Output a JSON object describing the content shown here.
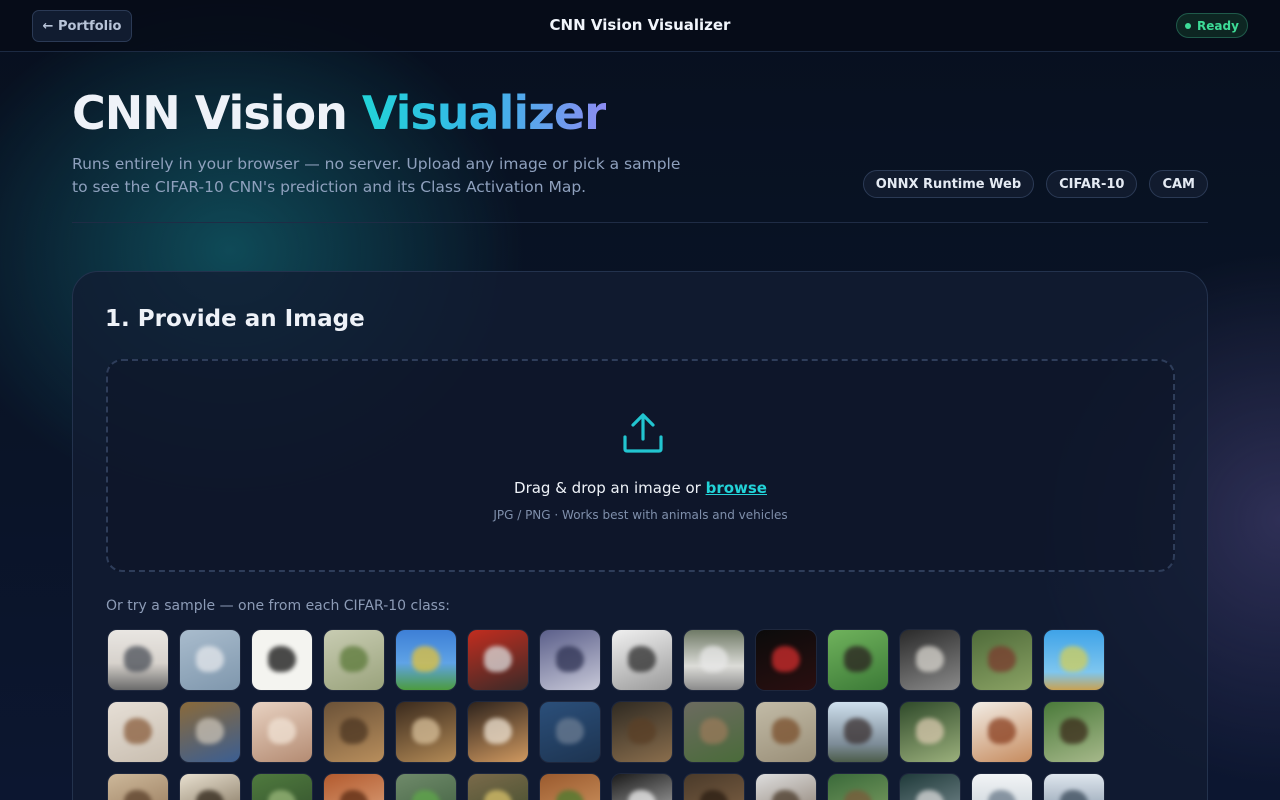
{
  "topbar": {
    "back_label": "← Portfolio",
    "title": "CNN Vision Visualizer",
    "status_label": "Ready",
    "status_color": "#3ddc97"
  },
  "hero": {
    "title_main": "CNN Vision ",
    "title_accent": "Visualizer",
    "subtitle_line1": "Runs entirely in your browser — no server. Upload any image or pick a sample",
    "subtitle_line2": "to see the CIFAR-10 CNN's prediction and its Class Activation Map.",
    "chips": [
      "ONNX Runtime Web",
      "CIFAR-10",
      "CAM"
    ]
  },
  "input_panel": {
    "title": "1. Provide an Image",
    "icon": "upload-icon",
    "drop_prefix": "Drag & drop an image or ",
    "browse_label": "browse",
    "hint": "JPG / PNG · Works best with animals and vehicles",
    "samples_label": "Or try a sample — one from each CIFAR-10 class:"
  },
  "samples": [
    {
      "bg": "linear-gradient(180deg,#e9e6e2 0%,#d7d2cc 55%,#6a6a6a 100%)",
      "fg": "#4a4f58"
    },
    {
      "bg": "linear-gradient(160deg,#a9bccd 0%,#7f97ad 100%)",
      "fg": "#e5e8ec"
    },
    {
      "bg": "#f4f4f0",
      "fg": "#111111"
    },
    {
      "bg": "linear-gradient(160deg,#c8ccb2 0%,#9aa37c 100%)",
      "fg": "#5c7a3a"
    },
    {
      "bg": "linear-gradient(180deg,#3d7fd6 0%,#5fa3e6 55%,#4c9b3e 100%)",
      "fg": "#e3c23a"
    },
    {
      "bg": "linear-gradient(160deg,#c22d1f 0%,#3a2a28 100%)",
      "fg": "#dcdcdc"
    },
    {
      "bg": "linear-gradient(160deg,#5b5f8a 0%,#c7c8d8 100%)",
      "fg": "#2d3152"
    },
    {
      "bg": "linear-gradient(160deg,#f0f0f0 0%,#9a9a9a 100%)",
      "fg": "#2e2e2e"
    },
    {
      "bg": "linear-gradient(180deg,#6f7a66 0%,#dcdcd8 60%,#8a8a8a 100%)",
      "fg": "#e8e8e8"
    },
    {
      "bg": "linear-gradient(160deg,#0b0b0b 0%,#2a0f10 100%)",
      "fg": "#d22d2d"
    },
    {
      "bg": "linear-gradient(160deg,#6fb25c 0%,#3c7a37 100%)",
      "fg": "#2a2020"
    },
    {
      "bg": "linear-gradient(160deg,#2a2a2a 0%,#8a8a8a 100%)",
      "fg": "#d9d6cf"
    },
    {
      "bg": "linear-gradient(160deg,#4f6b3a 0%,#8aa264 100%)",
      "fg": "#7a3b2e"
    },
    {
      "bg": "linear-gradient(180deg,#3fa3e8 0%,#7ec6ef 70%,#c8a253 100%)",
      "fg": "#d2cf5a"
    },
    {
      "bg": "linear-gradient(160deg,#e6dfd6 0%,#c9beb0 100%)",
      "fg": "#8a5e3d"
    },
    {
      "bg": "linear-gradient(160deg,#8a6a3a 0%,#3b5e92 100%)",
      "fg": "#c9c2b6"
    },
    {
      "bg": "linear-gradient(160deg,#e8d2c2 0%,#b48b72 100%)",
      "fg": "#f1e3d5"
    },
    {
      "bg": "linear-gradient(160deg,#6b5238 0%,#b88e5c 100%)",
      "fg": "#4c3622"
    },
    {
      "bg": "linear-gradient(160deg,#3a2a1d 0%,#b38a56 100%)",
      "fg": "#d8c09a"
    },
    {
      "bg": "linear-gradient(160deg,#2e231c 0%,#d09960 100%)",
      "fg": "#efe3d2"
    },
    {
      "bg": "linear-gradient(160deg,#2b4f7a 0%,#1d3451 100%)",
      "fg": "#6b7c92"
    },
    {
      "bg": "linear-gradient(160deg,#2f2a22 0%,#8a6e4d 100%)",
      "fg": "#5a3f26"
    },
    {
      "bg": "linear-gradient(160deg,#6c6b60 0%,#4a6b3a 100%)",
      "fg": "#9a7a5a"
    },
    {
      "bg": "linear-gradient(160deg,#c2bba7 0%,#9a8f78 100%)",
      "fg": "#7a4f2c"
    },
    {
      "bg": "linear-gradient(180deg,#cfe0ee 0%,#7d8c98 70%,#4c5c4a 100%)",
      "fg": "#3a3030"
    },
    {
      "bg": "linear-gradient(160deg,#2f4a2a 0%,#9bb07c 100%)",
      "fg": "#d9c9ae"
    },
    {
      "bg": "linear-gradient(160deg,#f2ede6 0%,#c68b5e 100%)",
      "fg": "#8a3f20"
    },
    {
      "bg": "linear-gradient(160deg,#4a7a3a 0%,#a6b88a 100%)",
      "fg": "#3a2a1a"
    },
    {
      "bg": "linear-gradient(160deg,#cdb89a 0%,#8c6d4f 100%)",
      "fg": "#5a3f2a"
    },
    {
      "bg": "linear-gradient(160deg,#e8e0d0 0%,#6a5a42 100%)",
      "fg": "#2e2418"
    },
    {
      "bg": "linear-gradient(160deg,#4f7a3e 0%,#2f4a2a 100%)",
      "fg": "#9ab87a"
    },
    {
      "bg": "linear-gradient(160deg,#b35a2e 0%,#e3b08a 100%)",
      "fg": "#5a2a12"
    },
    {
      "bg": "linear-gradient(160deg,#6f8a6a 0%,#3a5a3a 100%)",
      "fg": "#5fa84a"
    },
    {
      "bg": "linear-gradient(160deg,#7a6a4a 0%,#3a4a2a 100%)",
      "fg": "#d9c26a"
    },
    {
      "bg": "linear-gradient(160deg,#9a5a2e 0%,#d9a06a 100%)",
      "fg": "#4a7a2e"
    },
    {
      "bg": "linear-gradient(160deg,#1a1a1a 0%,#cfcfcf 100%)",
      "fg": "#efefef"
    },
    {
      "bg": "linear-gradient(160deg,#4a3a2a 0%,#8a6a4a 100%)",
      "fg": "#2a1d12"
    },
    {
      "bg": "linear-gradient(160deg,#dedede 0%,#7a6a5a 100%)",
      "fg": "#4a3a2a"
    },
    {
      "bg": "linear-gradient(160deg,#3a6a3a 0%,#8aa86a 100%)",
      "fg": "#7a5a3a"
    },
    {
      "bg": "linear-gradient(160deg,#1f3a3a 0%,#8a9aa0 100%)",
      "fg": "#d9d9d9"
    },
    {
      "bg": "linear-gradient(180deg,#f2f4f6 0%,#b8c4cc 100%)",
      "fg": "#6a7a8a"
    },
    {
      "bg": "linear-gradient(180deg,#dfe6ee 0%,#6a7f94 100%)",
      "fg": "#3a4a5a"
    }
  ]
}
